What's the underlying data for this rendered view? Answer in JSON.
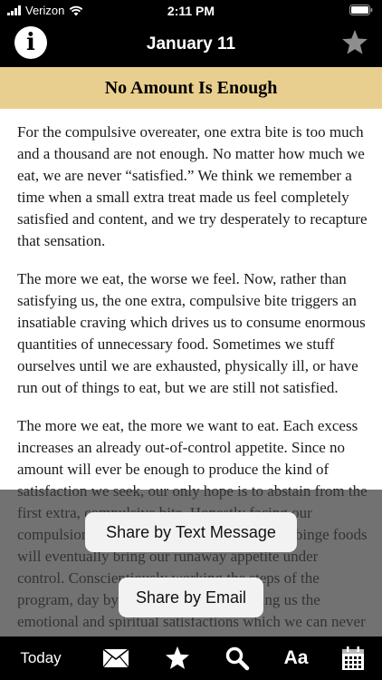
{
  "status": {
    "carrier": "Verizon",
    "time": "2:11 PM"
  },
  "header": {
    "date": "January 11",
    "info_glyph": "i",
    "info_icon": "info-icon",
    "fav_icon": "star-icon"
  },
  "reading": {
    "title": "No Amount Is Enough",
    "paragraphs": [
      "For the compulsive overeater, one extra bite is too much and a thousand are not enough. No matter how much we eat, we are never “satisfied.” We think we remember a time when a small extra treat made us feel completely satisfied and content, and we try desperately to recapture that sensation.",
      "The more we eat, the worse we feel. Now, rather than satisfying us, the one extra, compulsive bite triggers an insatiable craving which drives us to consume enormous quantities of unnecessary food. Sometimes we stuff ourselves until we are exhausted, physically ill, or have run out of things to eat, but we are still not satisfied.",
      "The more we eat, the more we want to eat. Each excess increases an already out-of-control appetite. Since no amount will ever be enough to produce the kind of satisfaction we seek, our only hope is to abstain from the first extra, compulsive bite. Honestly facing our compulsion and eliminating all excesses and binge foods will eventually bring our runaway appetite under control. Conscientiously working the steps of the program, day by day will day by day bring us the emotional and spiritual satisfactions which we can never acquire from food."
    ]
  },
  "share_menu": {
    "text_message": "Share by Text Message",
    "email": "Share by Email"
  },
  "tabbar": {
    "today": "Today",
    "font": "Aa"
  },
  "colors": {
    "banner": "#e9cf8f",
    "bar": "#000000",
    "favorite_star": "#8e8e8e"
  }
}
